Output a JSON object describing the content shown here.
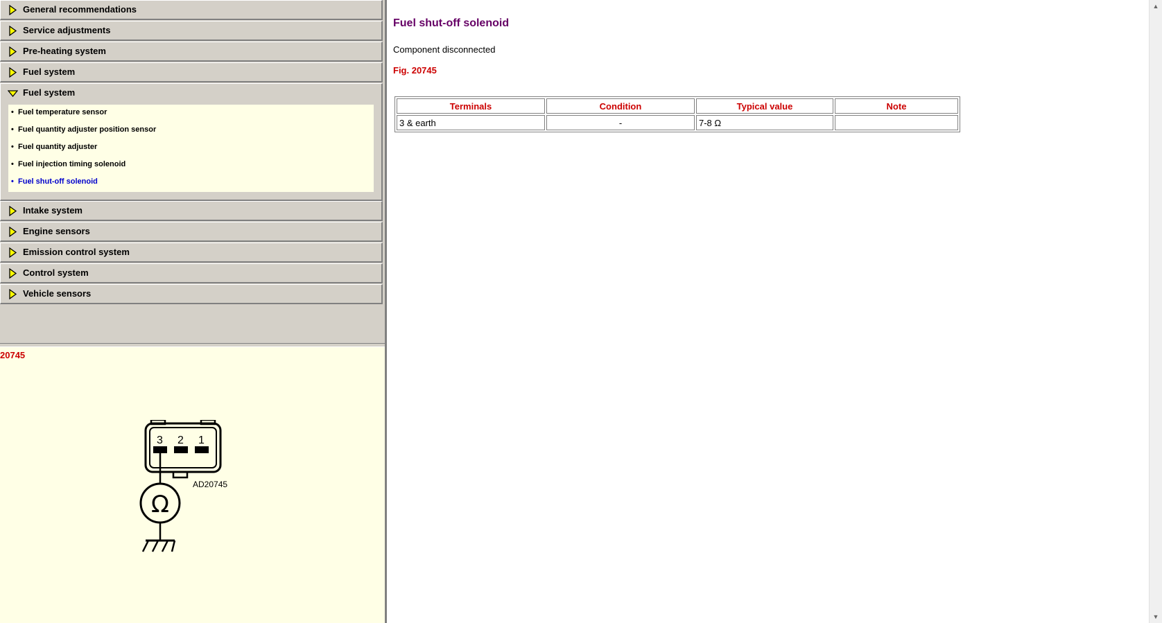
{
  "nav": {
    "items": [
      {
        "label": "General recommendations"
      },
      {
        "label": "Service adjustments"
      },
      {
        "label": "Pre-heating system"
      },
      {
        "label": "Fuel system"
      },
      {
        "label": "Fuel system"
      },
      {
        "label": "Intake system"
      },
      {
        "label": "Engine sensors"
      },
      {
        "label": "Emission control system"
      },
      {
        "label": "Control system"
      },
      {
        "label": "Vehicle sensors"
      }
    ],
    "submenu": [
      {
        "label": "Fuel temperature sensor"
      },
      {
        "label": "Fuel quantity adjuster position sensor"
      },
      {
        "label": "Fuel quantity adjuster"
      },
      {
        "label": "Fuel injection timing solenoid"
      },
      {
        "label": "Fuel shut-off solenoid"
      }
    ],
    "active_submenu": "Fuel shut-off solenoid",
    "expanded_item": 4
  },
  "figure_pane": {
    "number": "20745",
    "diagram": {
      "pins": [
        "3",
        "2",
        "1"
      ],
      "code": "AD20745",
      "symbol": "Ω"
    }
  },
  "main": {
    "title": "Fuel shut-off solenoid",
    "status": "Component disconnected",
    "fig_ref": "Fig. 20745",
    "table": {
      "headers": [
        "Terminals",
        "Condition",
        "Typical value",
        "Note"
      ],
      "rows": [
        [
          "3 & earth",
          "-",
          "7-8 Ω",
          ""
        ]
      ]
    }
  },
  "colors": {
    "panel": "#d4d0c8",
    "cream": "#ffffe6",
    "red": "#cc0000",
    "title_purple": "#660066",
    "link_blue": "#0000cc",
    "arrow_yellow": "#ffff00"
  }
}
